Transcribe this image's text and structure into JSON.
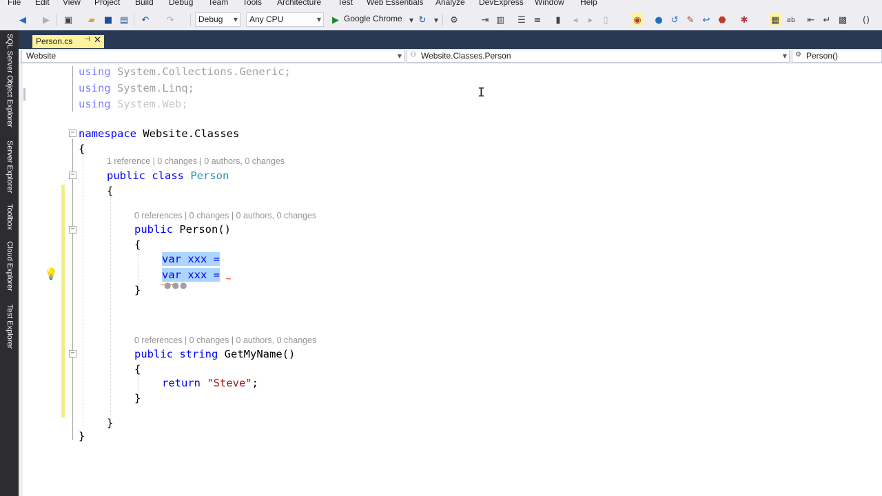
{
  "menu": [
    "File",
    "Edit",
    "View",
    "Project",
    "Build",
    "Debug",
    "Team",
    "Tools",
    "Architecture",
    "Test",
    "Web Essentials",
    "Analyze",
    "DevExpress",
    "Window",
    "Help"
  ],
  "toolbar": {
    "configuration": "Debug",
    "platform": "Any CPU",
    "start_target": "Google Chrome",
    "icons": [
      "back-icon",
      "forward-icon",
      "new-project-icon",
      "open-icon",
      "save-icon",
      "save-all-icon",
      "undo-icon",
      "redo-icon",
      "start-icon",
      "refresh-icon"
    ]
  },
  "side_tabs": [
    "SQL Server Object Explorer",
    "Server Explorer",
    "Toolbox",
    "Cloud Explorer",
    "Test Explorer"
  ],
  "document_tab": {
    "label": "Person.cs",
    "pin": "⊣",
    "close": "✕"
  },
  "nav": {
    "project": "Website",
    "class": "Website.Classes.Person",
    "member": "Person()"
  },
  "code": {
    "usings": [
      {
        "kw": "using",
        "ns": "System.Collections.Generic;"
      },
      {
        "kw": "using",
        "ns": "System.Linq;"
      },
      {
        "kw": "using",
        "ns": "System.Web;"
      }
    ],
    "namespace_kw": "namespace",
    "namespace_name": "Website.Classes",
    "open_brace": "{",
    "close_brace": "}",
    "class_lens": "1 reference | 0 changes | 0 authors, 0 changes",
    "class_decl_kw": "public class",
    "class_name": "Person",
    "ctor_lens": "0 references | 0 changes | 0 authors, 0 changes",
    "ctor_kw": "public",
    "ctor_name": "Person()",
    "var_line_1": "var xxx =",
    "var_line_2": "var xxx =",
    "method_lens": "0 references | 0 changes | 0 authors, 0 changes",
    "method_kw": "public string",
    "method_name": "GetMyName()",
    "return_kw": "return",
    "return_value": "\"Steve\"",
    "semicolon": ";"
  },
  "colors": {
    "keyword": "#0000ff",
    "type": "#2b91af",
    "string": "#a31515",
    "lens": "#959595",
    "selection": "#add6ff",
    "tab_active": "#fff29d",
    "tab_well": "#293955"
  }
}
